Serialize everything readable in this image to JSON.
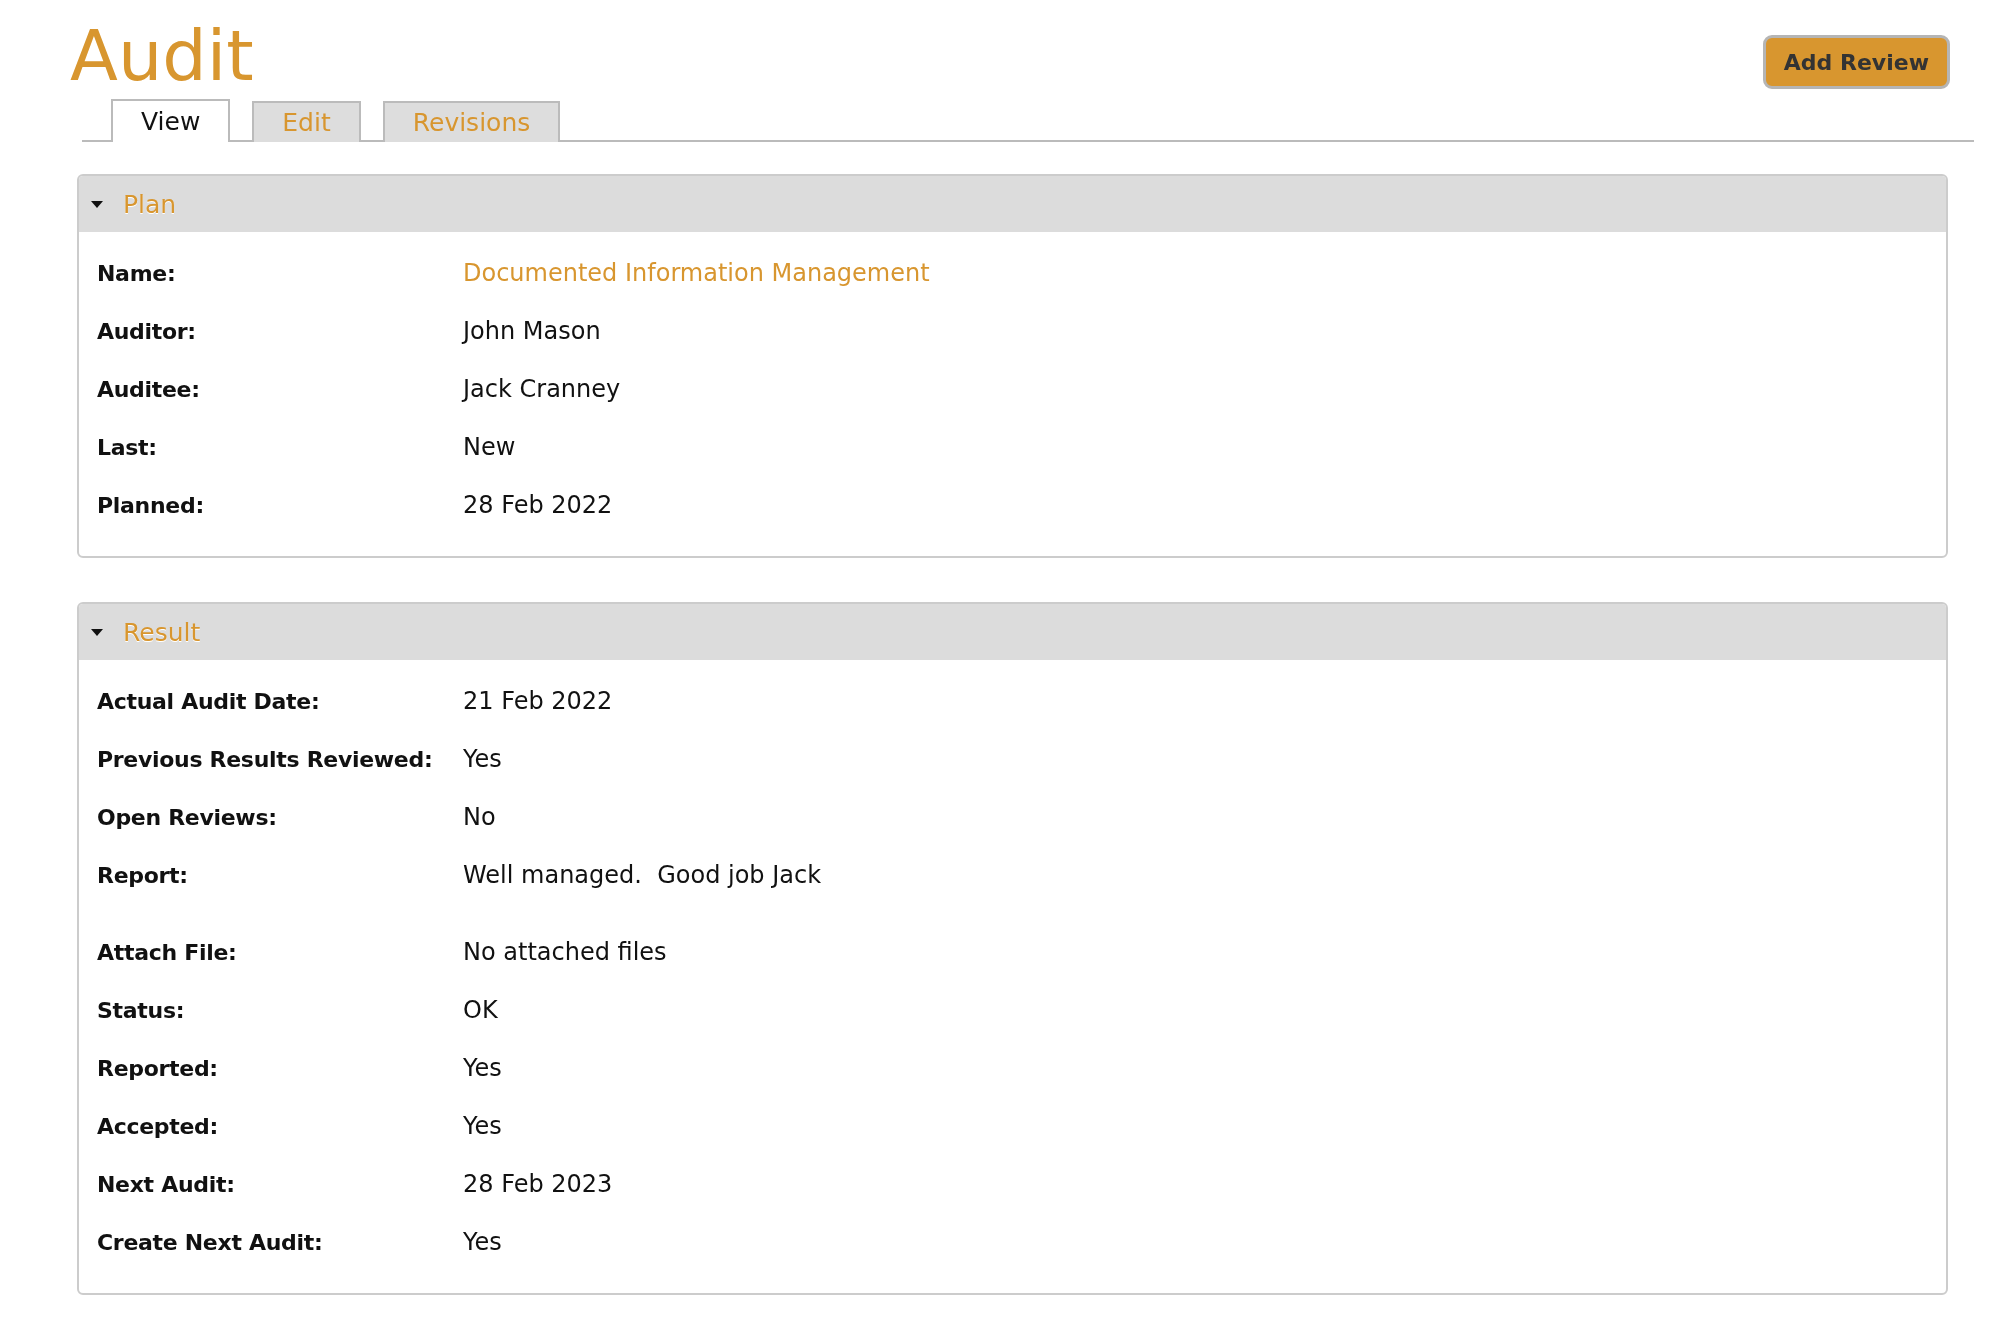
{
  "title": "Audit",
  "add_button": "Add Review",
  "tabs": [
    {
      "label": "View",
      "selected": true
    },
    {
      "label": "Edit",
      "selected": false
    },
    {
      "label": "Revisions",
      "selected": false
    }
  ],
  "sections": [
    {
      "title": "Plan",
      "expanded": true,
      "fields": [
        {
          "label": "Name:",
          "value": "Documented Information Management",
          "kind": "link"
        },
        {
          "label": "Auditor:",
          "value": "John Mason",
          "kind": "text"
        },
        {
          "label": "Auditee:",
          "value": "Jack Cranney",
          "kind": "text"
        },
        {
          "label": "Last:",
          "value": "New",
          "kind": "text"
        },
        {
          "label": "Planned:",
          "value": "28 Feb 2022",
          "kind": "text"
        }
      ]
    },
    {
      "title": "Result",
      "expanded": true,
      "fields": [
        {
          "label": "Actual Audit Date:",
          "value": "21 Feb 2022",
          "kind": "text"
        },
        {
          "label": "Previous Results Reviewed:",
          "value": "Yes",
          "kind": "text"
        },
        {
          "label": "Open Reviews:",
          "value": "No",
          "kind": "text"
        },
        {
          "label": "Report:",
          "value": "Well managed.  Good job Jack",
          "kind": "note"
        },
        {
          "label": "Attach File:",
          "value": "No attached files",
          "kind": "text"
        },
        {
          "label": "Status:",
          "value": "OK",
          "kind": "text"
        },
        {
          "label": "Reported:",
          "value": "Yes",
          "kind": "text"
        },
        {
          "label": "Accepted:",
          "value": "Yes",
          "kind": "text"
        },
        {
          "label": "Next Audit:",
          "value": "28 Feb 2023",
          "kind": "text"
        },
        {
          "label": "Create Next Audit:",
          "value": "Yes",
          "kind": "text"
        }
      ]
    }
  ]
}
